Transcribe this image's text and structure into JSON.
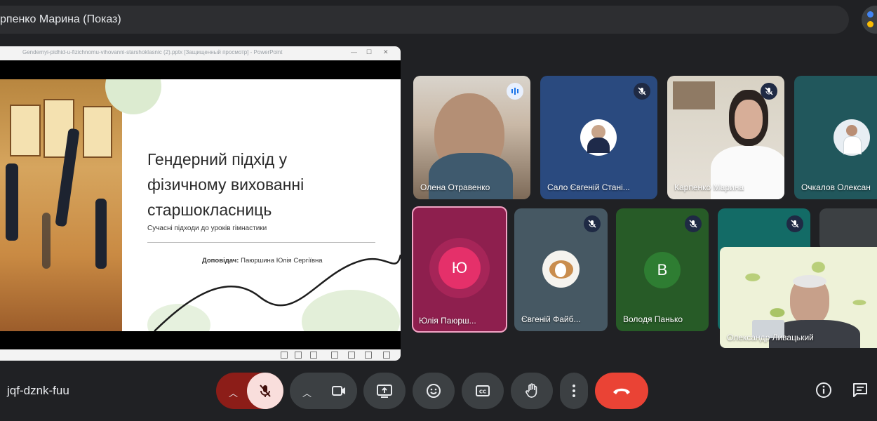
{
  "header": {
    "title": "рпенко Марина (Показ)"
  },
  "presentation": {
    "window_title": "Gendernyi-pidhid-u-fizichnomu-vihovanni-starshoklasnic (2).pptx [Защищенный просмотр] - PowerPoint",
    "slide_title": "Гендерний підхід у фізичному вихованні старшокласниць",
    "slide_subtitle": "Сучасні підходи до уроків гімнастики",
    "speaker_label": "Доповідач:",
    "speaker_name": "Паюршина Юлія Сергіївна"
  },
  "participants": [
    {
      "name": "Олена Отравенко",
      "status": "speaking"
    },
    {
      "name": "Сало Євгеній Стані...",
      "status": "muted"
    },
    {
      "name": "Карпенко Марина",
      "status": "muted"
    },
    {
      "name": "Очкалов Олексан",
      "status": "none"
    },
    {
      "name": "Юлія Паюрш...",
      "initial": "Ю",
      "status": "active"
    },
    {
      "name": "Євгеній Файб...",
      "status": "muted"
    },
    {
      "name": "Володя Панько",
      "initial": "В",
      "status": "muted"
    },
    {
      "name": "",
      "status": "muted"
    },
    {
      "name": "Олександр Ливацький",
      "status": "self"
    }
  ],
  "controls": {
    "meeting_code": "jqf-dznk-fuu",
    "mic": "muted",
    "buttons": [
      "mic",
      "camera",
      "present",
      "reactions",
      "captions",
      "raise-hand",
      "more-options",
      "leave-call"
    ]
  },
  "colors": {
    "background": "#202124",
    "leave": "#ea4335",
    "mic_muted_bg": "#f9dedc",
    "accent_pink": "#b3235c"
  }
}
